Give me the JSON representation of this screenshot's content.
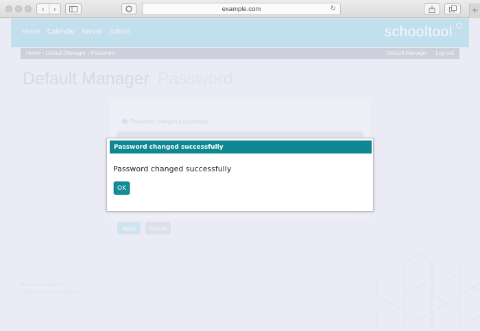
{
  "browser": {
    "address": "example.com"
  },
  "app": {
    "brand": "schooltool",
    "nav": [
      "Home",
      "Calendar",
      "Server",
      "School"
    ],
    "breadcrumbs": "Home  ›  Default Manager  ›  Password",
    "user_name": "Default Manager",
    "logout_label": "Log out",
    "page_title": "Default Manager",
    "page_subtitle": "Password",
    "info_message": "Password changed successfully",
    "apply_label": "Apply",
    "cancel_label": "Cancel",
    "footer": [
      "Powered by SchoolTool",
      "Copyright SchoolTool Foundation"
    ]
  },
  "dialog": {
    "title": "Password changed successfully",
    "message": "Password changed successfully",
    "ok_label": "OK"
  },
  "colors": {
    "dialog_header": "#0f8892",
    "ok_button": "#138e96",
    "topbar": "#9fd6e6",
    "page_background": "#ebebf5"
  }
}
